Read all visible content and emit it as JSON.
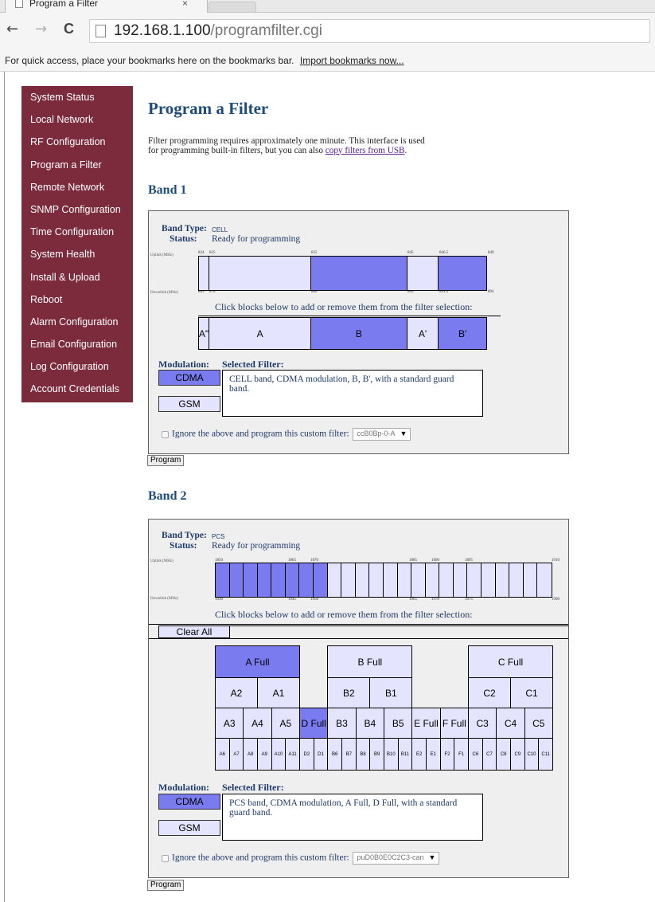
{
  "browser": {
    "tab_title": "Program a Filter",
    "tab_close": "×",
    "back": "←",
    "forward": "→",
    "reload": "C",
    "url_host": "192.168.1.100",
    "url_path": "/programfilter.cgi",
    "bookmarks_text": "For quick access, place your bookmarks here on the bookmarks bar.",
    "bookmarks_link": "Import bookmarks now..."
  },
  "sidebar": {
    "items": [
      {
        "label": "System Status"
      },
      {
        "label": "Local Network"
      },
      {
        "label": "RF Configuration"
      },
      {
        "label": "Program a Filter"
      },
      {
        "label": "Remote Network"
      },
      {
        "label": "SNMP Configuration"
      },
      {
        "label": "Time Configuration"
      },
      {
        "label": "System Health"
      },
      {
        "label": "Install & Upload"
      },
      {
        "label": "Reboot"
      },
      {
        "label": "Alarm Configuration"
      },
      {
        "label": "Email Configuration"
      },
      {
        "label": "Log Configuration"
      },
      {
        "label": "Account Credentials"
      }
    ],
    "bg_color": "#7b2b3c"
  },
  "page": {
    "title": "Program a Filter",
    "intro": "Filter programming requires approximately one minute. This interface is used for programming built-in filters, but you can also",
    "intro_link": "copy filters from USB",
    "intro_end": "."
  },
  "common": {
    "band_type_label": "Band Type:",
    "status_label": "Status:",
    "uplink_label": "Uplink (MHz)",
    "downlink_label": "Downlink (MHz)",
    "hint": "Click blocks below to add or remove them from the filter selection:",
    "modulation_label": "Modulation:",
    "selected_filter_label": "Selected Filter:",
    "cdma": "CDMA",
    "gsm": "GSM",
    "custom_label": "Ignore the above and program this custom filter:",
    "program": "Program",
    "clear_all": "Clear All",
    "dropdown_arrow": "▼",
    "selected_color": "#7b7bf0",
    "unselected_color": "#e4e4ff",
    "heading_color": "#1e4c7a"
  },
  "band1": {
    "heading": "Band 1",
    "band_type": "CELL",
    "status": "Ready for programming",
    "uplink_ticks": [
      "824",
      "825",
      "835",
      "845",
      "846.5",
      "849"
    ],
    "downlink_ticks": [
      "869",
      "870",
      "880",
      "890",
      "891.5",
      "894"
    ],
    "blocks": [
      {
        "label": "A\"",
        "selected": false
      },
      {
        "label": "A",
        "selected": false
      },
      {
        "label": "B",
        "selected": true
      },
      {
        "label": "A'",
        "selected": false
      },
      {
        "label": "B'",
        "selected": true
      }
    ],
    "modulation_selected": "CDMA",
    "selected_filter": "CELL band, CDMA modulation, B, B', with a standard guard band.",
    "custom_filter_value": "ccB0Bp-0-A"
  },
  "band2": {
    "heading": "Band 2",
    "band_type": "PCS",
    "status": "Ready for programming",
    "uplink_ticks": [
      "1850",
      "1865",
      "1870",
      "1885",
      "1890",
      "1895",
      "1910"
    ],
    "downlink_ticks": [
      "1930",
      "1945",
      "1950",
      "1965",
      "1970",
      "1975",
      "1990"
    ],
    "full_row": [
      {
        "label": "A Full",
        "selected": true
      },
      {
        "label": "B Full",
        "selected": false
      },
      {
        "label": "C Full",
        "selected": false
      }
    ],
    "half_row": [
      {
        "label": "A2",
        "selected": false
      },
      {
        "label": "A1",
        "selected": false
      },
      {
        "label": "B2",
        "selected": false
      },
      {
        "label": "B1",
        "selected": false
      },
      {
        "label": "C2",
        "selected": false
      },
      {
        "label": "C1",
        "selected": false
      }
    ],
    "mid_row": [
      {
        "label": "A3",
        "selected": false
      },
      {
        "label": "A4",
        "selected": false
      },
      {
        "label": "A5",
        "selected": false
      },
      {
        "label": "D Full",
        "selected": true
      },
      {
        "label": "B3",
        "selected": false
      },
      {
        "label": "B4",
        "selected": false
      },
      {
        "label": "B5",
        "selected": false
      },
      {
        "label": "E Full",
        "selected": false
      },
      {
        "label": "F Full",
        "selected": false
      },
      {
        "label": "C3",
        "selected": false
      },
      {
        "label": "C4",
        "selected": false
      },
      {
        "label": "C5",
        "selected": false
      }
    ],
    "small_row": [
      "A6",
      "A7",
      "A8",
      "A9",
      "A10",
      "A11",
      "D2",
      "D1",
      "B6",
      "B7",
      "B8",
      "B9",
      "B10",
      "B11",
      "E2",
      "E1",
      "F2",
      "F1",
      "C6",
      "C7",
      "C8",
      "C9",
      "C10",
      "C11"
    ],
    "modulation_selected": "CDMA",
    "selected_filter": "PCS band, CDMA modulation, A Full, D Full, with a standard guard band.",
    "custom_filter_value": "puD0B0E0C2C3-can"
  }
}
